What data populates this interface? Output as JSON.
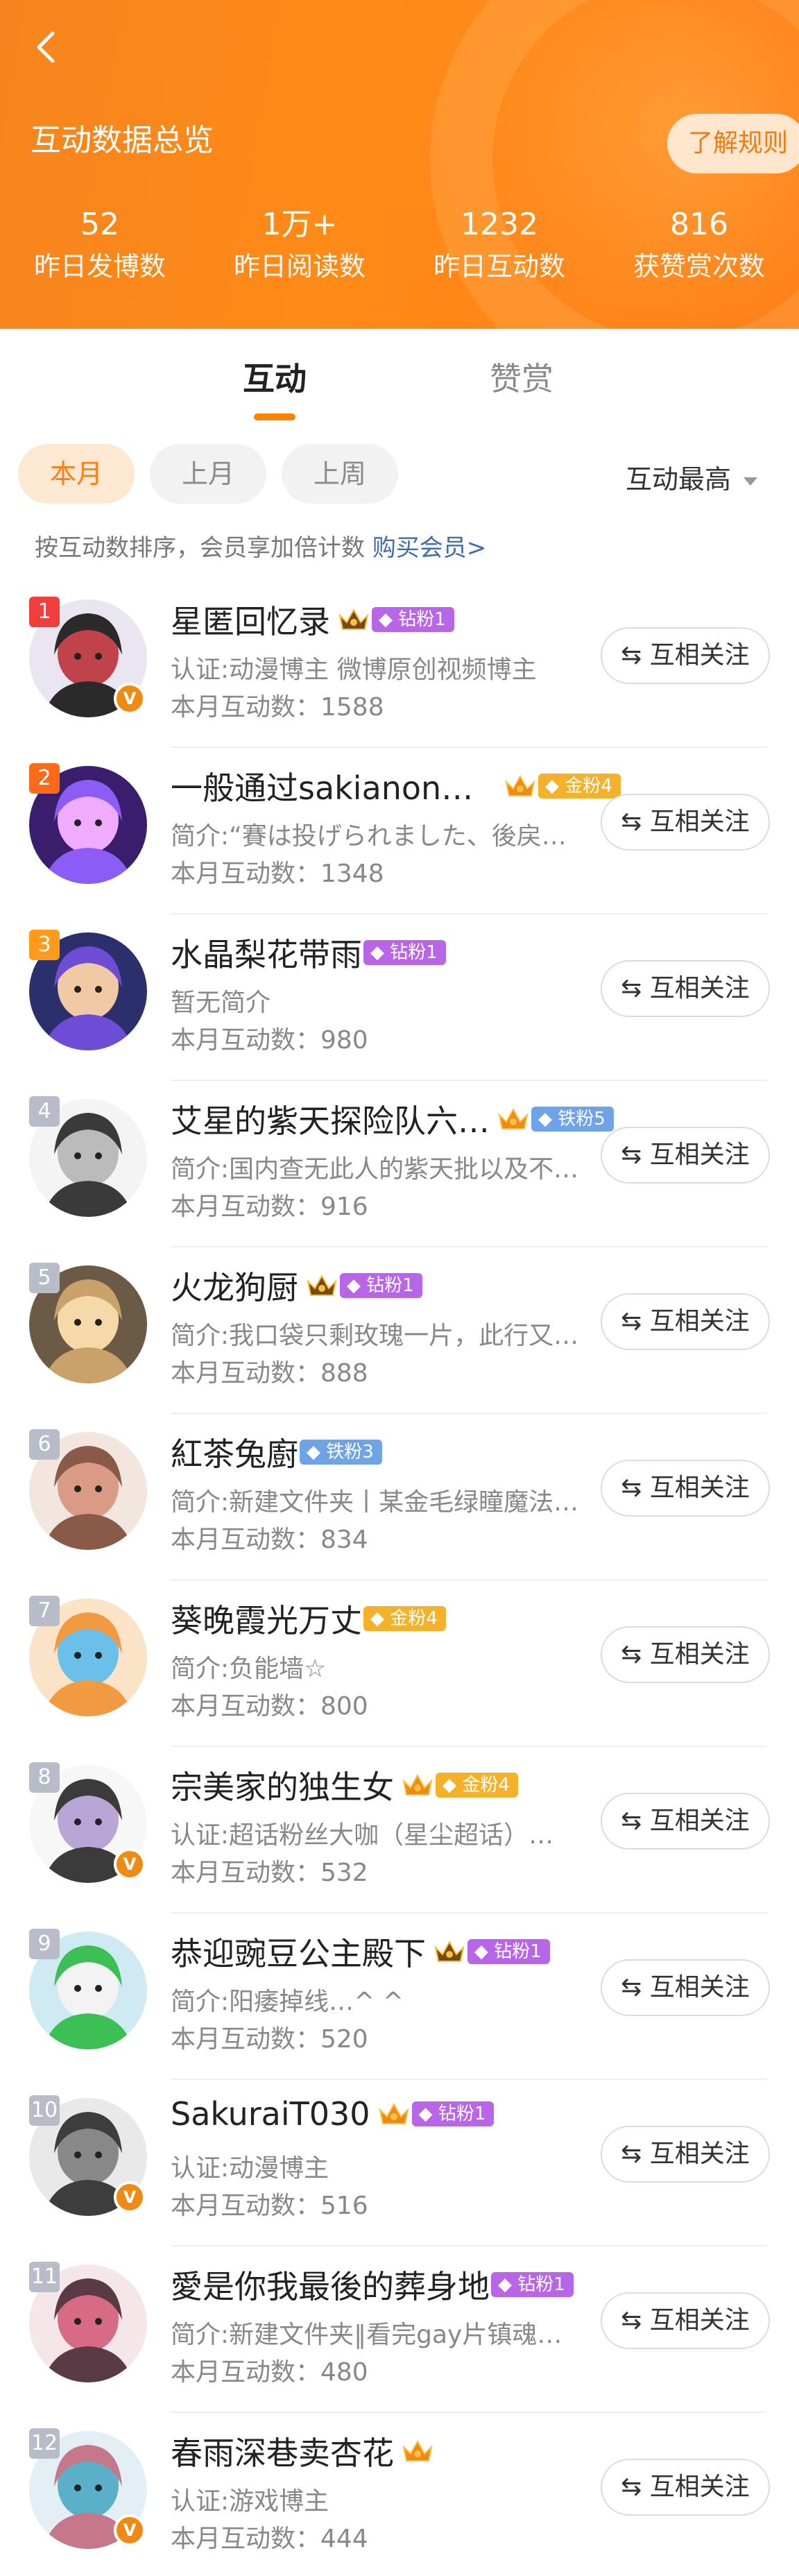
{
  "header": {
    "title": "互动数据总览",
    "rules_button": "了解规则",
    "stats": [
      {
        "value": "52",
        "label": "昨日发博数"
      },
      {
        "value": "1万+",
        "label": "昨日阅读数"
      },
      {
        "value": "1232",
        "label": "昨日互动数"
      },
      {
        "value": "816",
        "label": "获赞赏次数"
      }
    ]
  },
  "tabs": [
    {
      "label": "互动",
      "active": true
    },
    {
      "label": "赞赏",
      "active": false
    }
  ],
  "filters": {
    "chips": [
      {
        "label": "本月",
        "active": true
      },
      {
        "label": "上月",
        "active": false
      },
      {
        "label": "上周",
        "active": false
      }
    ],
    "sort_label": "互动最高"
  },
  "hint": {
    "text": "按互动数排序，会员享加倍计数 ",
    "link": "购买会员>"
  },
  "follow_label": "⇆ 互相关注",
  "colors": {
    "accent": "#ff8200",
    "rank1": "#f23d3d",
    "rank2": "#ff6a1a",
    "rank3": "#ff9a1a",
    "rank_other": "#b8bcc8",
    "fan_diamond": "#b865e8",
    "fan_gold": "#f5b12a",
    "fan_iron": "#6fa3e8",
    "verified": "#f08a12"
  },
  "users": [
    {
      "rank": "1",
      "name": "星匿回忆录",
      "crown": true,
      "fan": "钻粉1",
      "fan_type": "diamond",
      "desc": "认证:动漫博主 微博原创视频博主",
      "count": "本月互动数：1588",
      "verified": true
    },
    {
      "rank": "2",
      "name": "一般通过sakianon厨…",
      "crown": true,
      "fan": "金粉4",
      "fan_type": "gold",
      "desc": "简介:“賽は投げられました、後戻…",
      "count": "本月互动数：1348",
      "verified": false
    },
    {
      "rank": "3",
      "name": "水晶梨花带雨",
      "crown": false,
      "fan": "钻粉1",
      "fan_type": "diamond",
      "desc": "暂无简介",
      "count": "本月互动数：980",
      "verified": false
    },
    {
      "rank": "4",
      "name": "艾星的紫天探险队六…",
      "crown": true,
      "fan": "铁粉5",
      "fan_type": "iron",
      "desc": "简介:国内查无此人的紫天批以及不…",
      "count": "本月互动数：916",
      "verified": false
    },
    {
      "rank": "5",
      "name": "火龙狗厨",
      "crown": true,
      "fan": "钻粉1",
      "fan_type": "diamond",
      "desc": "简介:我口袋只剩玫瑰一片，此行又…",
      "count": "本月互动数：888",
      "verified": false
    },
    {
      "rank": "6",
      "name": "紅茶兔廚",
      "crown": false,
      "fan": "铁粉3",
      "fan_type": "iron",
      "desc": "简介:新建文件夹丨某金毛绿瞳魔法…",
      "count": "本月互动数：834",
      "verified": false
    },
    {
      "rank": "7",
      "name": "葵晚霞光万丈",
      "crown": false,
      "fan": "金粉4",
      "fan_type": "gold",
      "desc": "简介:负能墙☆",
      "count": "本月互动数：800",
      "verified": false
    },
    {
      "rank": "8",
      "name": "宗美家的独生女",
      "crown": true,
      "fan": "金粉4",
      "fan_type": "gold",
      "desc": "认证:超话粉丝大咖（星尘超话）…",
      "count": "本月互动数：532",
      "verified": true
    },
    {
      "rank": "9",
      "name": "恭迎豌豆公主殿下",
      "crown": true,
      "fan": "钻粉1",
      "fan_type": "diamond",
      "desc": "简介:阳痿掉线…^ ^",
      "count": "本月互动数：520",
      "verified": false
    },
    {
      "rank": "10",
      "name": "SakuraiT030",
      "crown": true,
      "fan": "钻粉1",
      "fan_type": "diamond",
      "desc": "认证:动漫博主",
      "count": "本月互动数：516",
      "verified": true
    },
    {
      "rank": "11",
      "name": "愛是你我最後的葬身地",
      "crown": false,
      "fan": "钻粉1",
      "fan_type": "diamond",
      "desc": "简介:新建文件夹‖看完gay片镇魂…",
      "count": "本月互动数：480",
      "verified": false
    },
    {
      "rank": "12",
      "name": "春雨深巷卖杏花",
      "crown": true,
      "fan": "",
      "fan_type": "none",
      "desc": "认证:游戏博主",
      "count": "本月互动数：444",
      "verified": true
    }
  ]
}
